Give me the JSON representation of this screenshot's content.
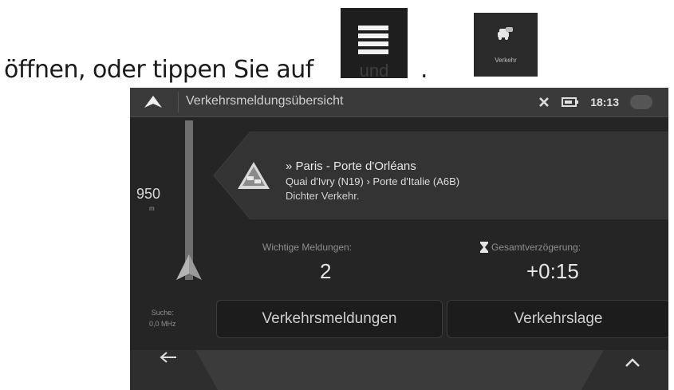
{
  "instruction": {
    "text": "öffnen, oder tippen Sie auf",
    "period": ".",
    "menu_button_label": "und",
    "traffic_button_label": "Verkehr"
  },
  "screen": {
    "topbar": {
      "title": "Verkehrsmeldungsübersicht",
      "time": "18:13"
    },
    "route": {
      "distance_value": "950",
      "distance_unit": "m"
    },
    "event": {
      "title": "» Paris - Porte d'Orléans",
      "road": "Quai d'Ivry (N19) › Porte d'Italie (A6B)",
      "description": "Dichter Verkehr."
    },
    "stats": {
      "important_label": "Wichtige Meldungen:",
      "important_value": "2",
      "delay_label": "Gesamtverzögerung:",
      "delay_value": "+0:15"
    },
    "fm": {
      "line1": "Suche:",
      "line2": "0,0 MHz"
    },
    "buttons": {
      "messages": "Verkehrsmeldungen",
      "situation": "Verkehrslage"
    }
  },
  "colors": {
    "screen_bg": "#2b2b2b",
    "route_line": "#6f6f6f",
    "text_light": "#e8e8e8"
  }
}
